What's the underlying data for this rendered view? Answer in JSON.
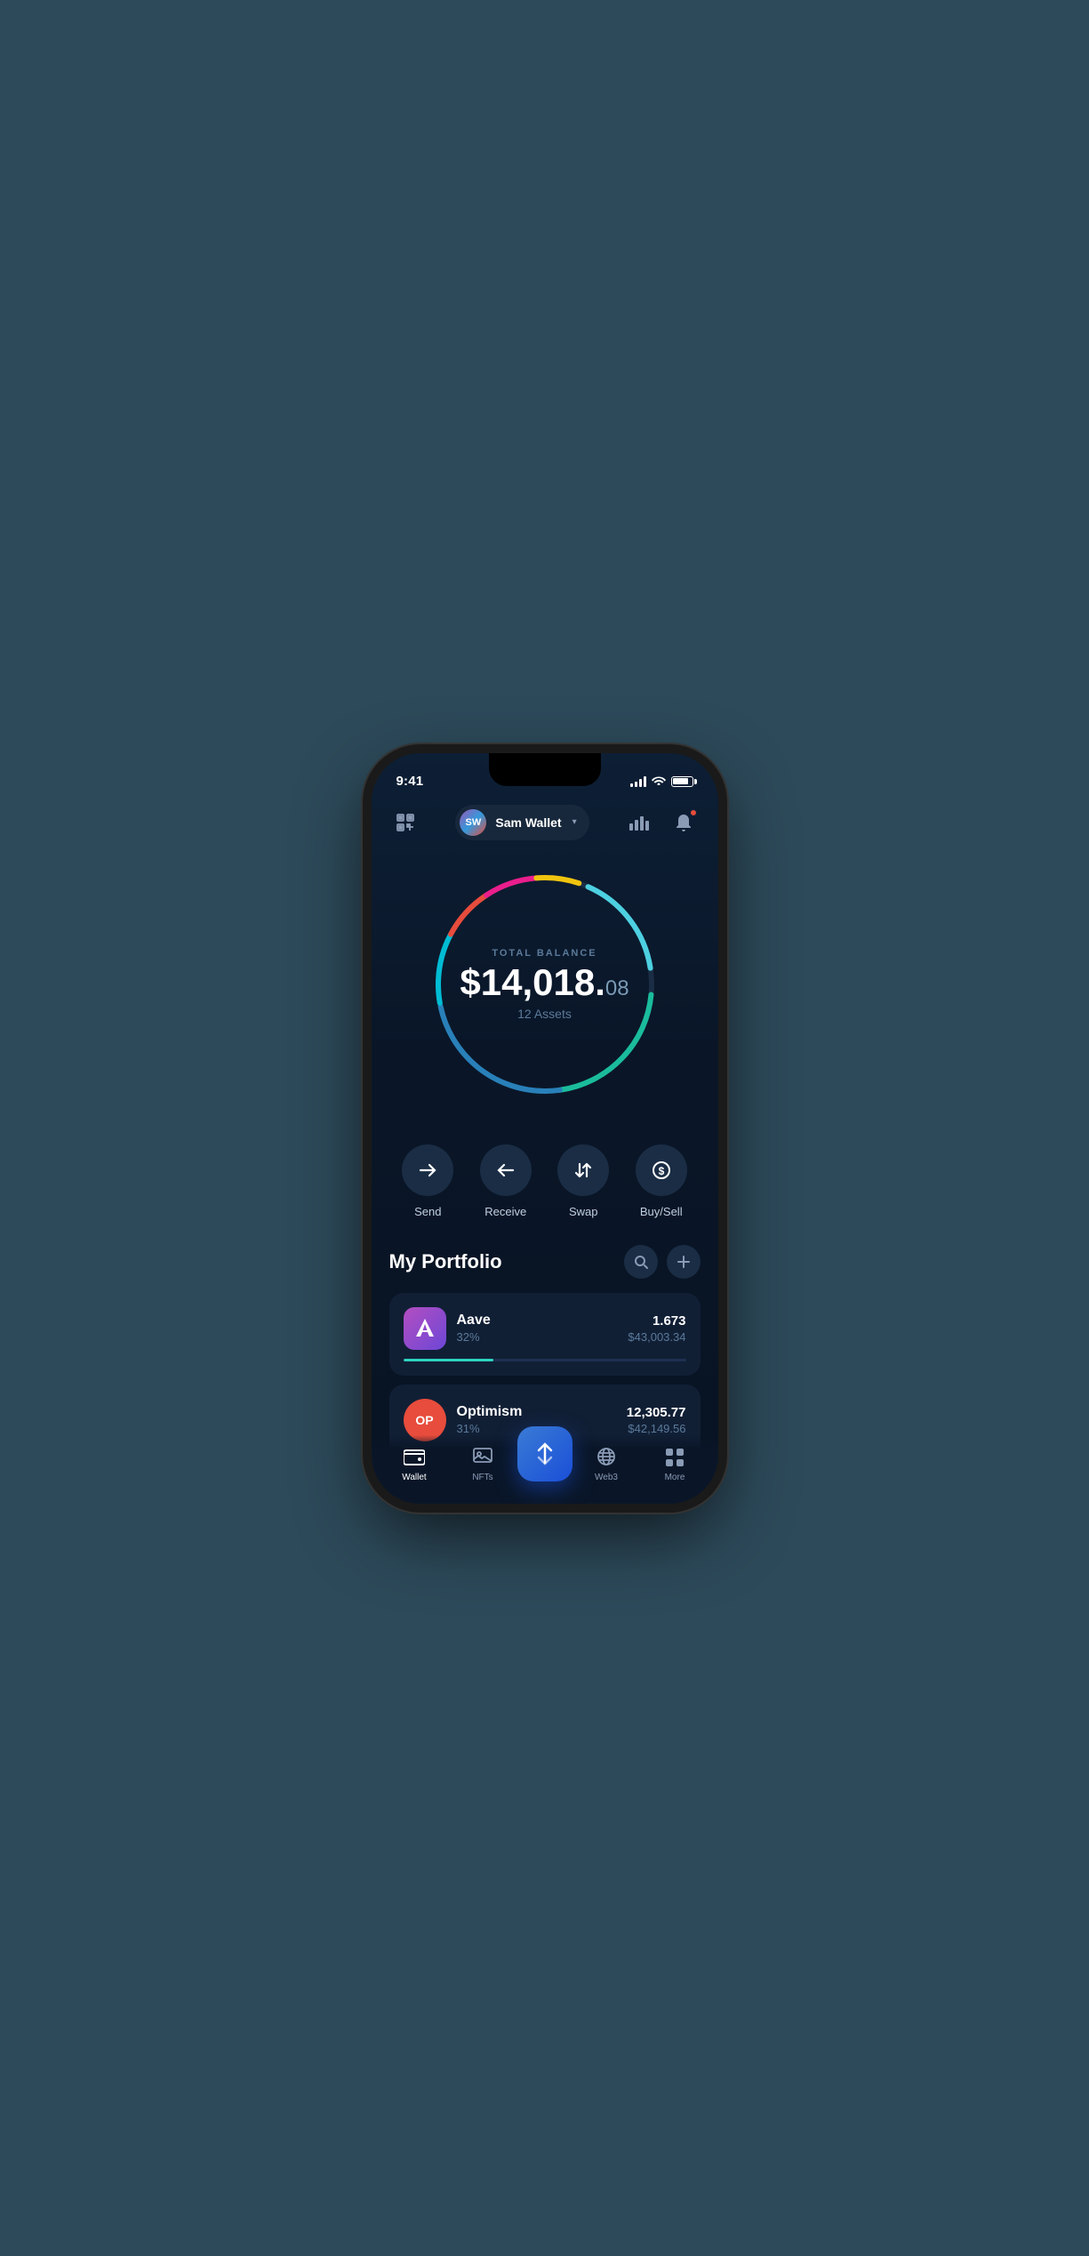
{
  "status_bar": {
    "time": "9:41"
  },
  "header": {
    "wallet_initials": "SW",
    "wallet_name": "Sam Wallet",
    "chevron": "▾"
  },
  "balance": {
    "label": "TOTAL BALANCE",
    "amount_main": "$14,018.",
    "amount_cents": "08",
    "assets_label": "12 Assets"
  },
  "actions": [
    {
      "id": "send",
      "label": "Send",
      "icon": "→"
    },
    {
      "id": "receive",
      "label": "Receive",
      "icon": "←"
    },
    {
      "id": "swap",
      "label": "Swap",
      "icon": "⇅"
    },
    {
      "id": "buysell",
      "label": "Buy/Sell",
      "icon": "$"
    }
  ],
  "portfolio": {
    "title": "My Portfolio"
  },
  "assets": [
    {
      "id": "aave",
      "name": "Aave",
      "percentage": "32%",
      "amount": "1.673",
      "usd": "$43,003.34",
      "progress": 32,
      "progress_color": "#2dd4bf",
      "icon_text": "Λ",
      "icon_class": "aave-icon"
    },
    {
      "id": "optimism",
      "name": "Optimism",
      "percentage": "31%",
      "amount": "12,305.77",
      "usd": "$42,149.56",
      "progress": 31,
      "progress_color": "#e74c3c",
      "icon_text": "OP",
      "icon_class": "op-icon"
    }
  ],
  "bottom_nav": [
    {
      "id": "wallet",
      "label": "Wallet",
      "active": true
    },
    {
      "id": "nfts",
      "label": "NFTs",
      "active": false
    },
    {
      "id": "center",
      "label": "",
      "active": false,
      "is_center": true
    },
    {
      "id": "web3",
      "label": "Web3",
      "active": false
    },
    {
      "id": "more",
      "label": "More",
      "active": false
    }
  ]
}
